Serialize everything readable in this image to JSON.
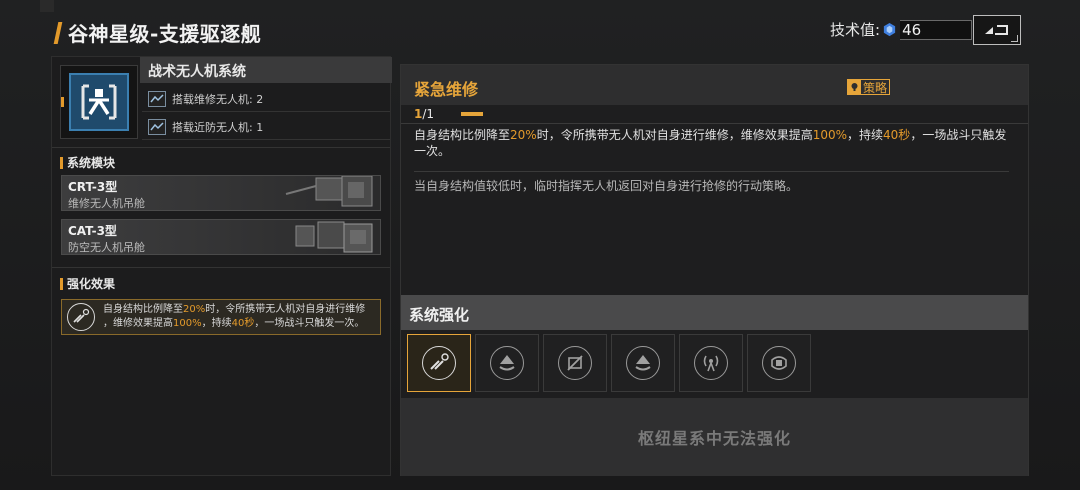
{
  "header": {
    "title": "谷神星级-支援驱逐舰",
    "tech_label": "技术值:",
    "tech_value": "46",
    "back_icon": "return-arrow-icon",
    "accent_color": "#e39a2b"
  },
  "left": {
    "system_name": "战术无人机系统",
    "drones": [
      {
        "label": "搭载维修无人机: 2",
        "icon": "drone-bay-icon"
      },
      {
        "label": "搭载近防无人机: 1",
        "icon": "drone-bay-icon"
      }
    ],
    "modules_heading": "系统模块",
    "modules": [
      {
        "name": "CRT-3型",
        "sub": "维修无人机吊舱"
      },
      {
        "name": "CAT-3型",
        "sub": "防空无人机吊舱"
      }
    ],
    "enhance_heading": "强化效果",
    "enhance": {
      "t1": "自身结构比例降至",
      "v1": "20%",
      "t2": "时，令所携带无人机对自身进行维修",
      "t3": "，维修效果提高",
      "v2": "100%",
      "t4": "，持续",
      "v3": "40秒",
      "t5": "，一场战斗只触发一次。"
    }
  },
  "right": {
    "skill_title": "紧急维修",
    "strategy_label": "策略",
    "level_current": "1",
    "level_sep": "/1",
    "desc": {
      "t1": "自身结构比例降至",
      "v1": "20%",
      "t2": "时，令所携带无人机对自身进行维修，维修效果提高",
      "v2": "100%",
      "t3": "，持续",
      "v3": "40秒",
      "t4": "，一场战斗只触发一次。"
    },
    "flavor": "当自身结构值较低时，临时指挥无人机返回对自身进行抢修的行动策略。",
    "sys_enhance_title": "系统强化",
    "slots": [
      {
        "icon": "repair-drone-icon",
        "active": true
      },
      {
        "icon": "upgrade-chevron-icon",
        "active": false
      },
      {
        "icon": "drone-disabled-icon",
        "active": false
      },
      {
        "icon": "upgrade-chevron-icon",
        "active": false
      },
      {
        "icon": "signal-tower-icon",
        "active": false
      },
      {
        "icon": "shield-drone-icon",
        "active": false
      }
    ],
    "cannot_enhance": "枢纽星系中无法强化"
  }
}
